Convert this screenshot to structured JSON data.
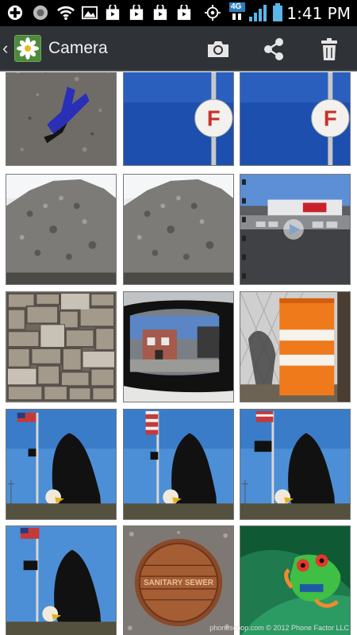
{
  "status_bar": {
    "time": "1:41 PM",
    "network": "4G",
    "icons": [
      "add-icon",
      "circle-icon",
      "wifi-icon",
      "image-icon",
      "bag-icon",
      "bag-icon",
      "bag-icon",
      "bag-icon",
      "gps-icon",
      "4g-icon",
      "signal-icon",
      "battery-icon"
    ]
  },
  "action_bar": {
    "title": "Camera",
    "actions": [
      "camera-icon",
      "share-icon",
      "delete-icon"
    ]
  },
  "gallery": {
    "items": [
      {
        "subject": "blue object on gravel",
        "type": "photo"
      },
      {
        "subject": "F sign against blue sky",
        "type": "photo"
      },
      {
        "subject": "F sign against blue sky",
        "type": "photo"
      },
      {
        "subject": "rock pile",
        "type": "photo"
      },
      {
        "subject": "rock pile",
        "type": "photo"
      },
      {
        "subject": "store parking lot",
        "type": "video"
      },
      {
        "subject": "stone wall",
        "type": "photo"
      },
      {
        "subject": "car side mirror",
        "type": "photo"
      },
      {
        "subject": "orange traffic barrel",
        "type": "photo"
      },
      {
        "subject": "eagle statue with flags",
        "type": "photo"
      },
      {
        "subject": "eagle statue with flags",
        "type": "photo"
      },
      {
        "subject": "eagle statue with flags",
        "type": "photo"
      },
      {
        "subject": "eagle statue with flags",
        "type": "photo"
      },
      {
        "subject": "sanitary sewer manhole cover",
        "type": "photo",
        "text": "SANITARY SEWER"
      },
      {
        "subject": "green tree frog",
        "type": "photo"
      }
    ]
  },
  "watermark": "phonescoop.com © 2012 Phone Factor LLC"
}
